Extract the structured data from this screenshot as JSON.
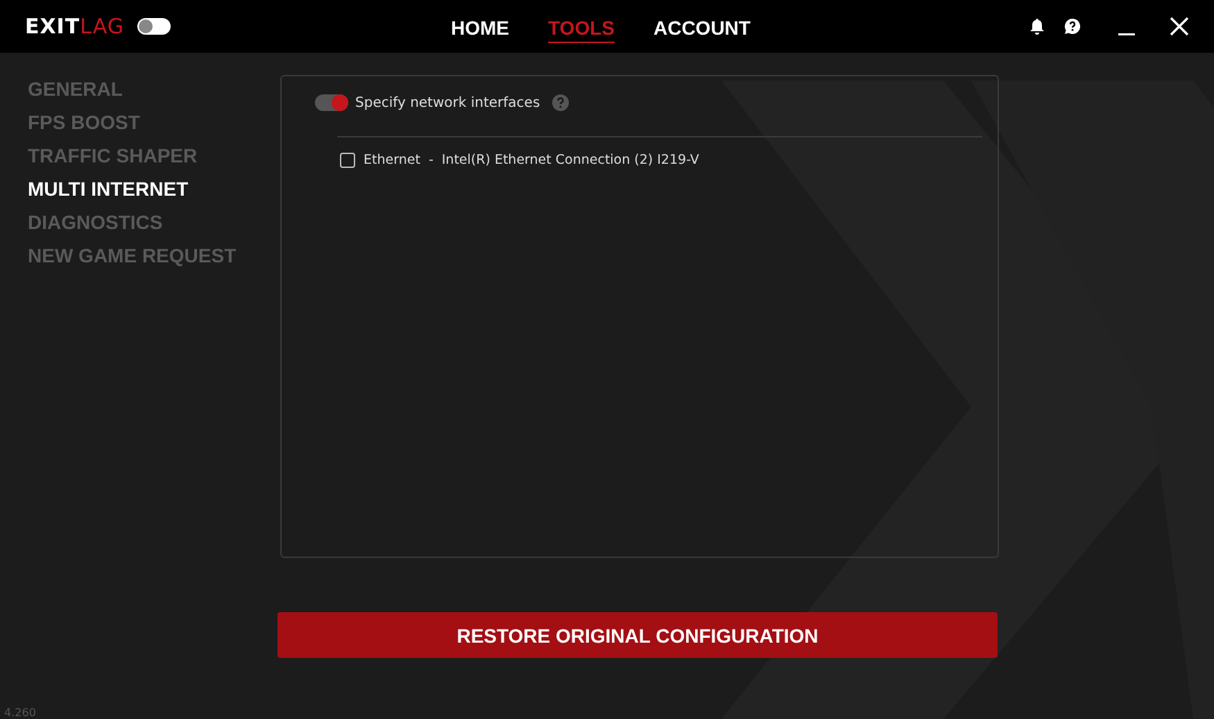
{
  "header": {
    "logo_main": "EXIT",
    "logo_accent": "LAG",
    "mode_toggle": {
      "on": false
    },
    "nav": [
      {
        "label": "HOME",
        "selected": false
      },
      {
        "label": "TOOLS",
        "selected": true
      },
      {
        "label": "ACCOUNT",
        "selected": false
      }
    ]
  },
  "sidebar": {
    "items": [
      {
        "label": "GENERAL",
        "selected": false
      },
      {
        "label": "FPS BOOST",
        "selected": false
      },
      {
        "label": "TRAFFIC SHAPER",
        "selected": false
      },
      {
        "label": "MULTI INTERNET",
        "selected": true
      },
      {
        "label": "DIAGNOSTICS",
        "selected": false
      },
      {
        "label": "NEW GAME REQUEST",
        "selected": false
      }
    ]
  },
  "panel": {
    "specify_toggle": {
      "label": "Specify network interfaces",
      "on": true
    },
    "interfaces": [
      {
        "name": "Ethernet",
        "separator": "-",
        "adapter": "Intel(R) Ethernet Connection (2) I219-V",
        "checked": false
      }
    ]
  },
  "restore_button": "RESTORE ORIGINAL CONFIGURATION",
  "version": "4.260"
}
